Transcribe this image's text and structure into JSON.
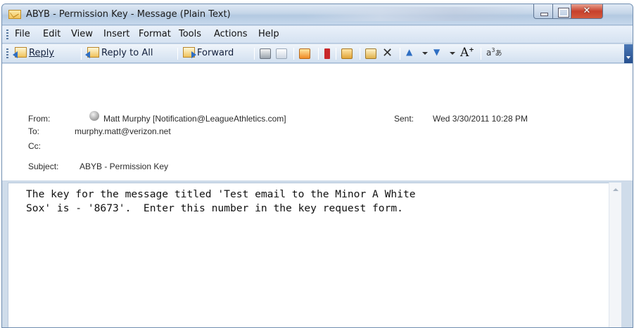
{
  "window": {
    "title": "ABYB - Permission Key - Message (Plain Text)"
  },
  "menu": [
    {
      "label": "File"
    },
    {
      "label": "Edit"
    },
    {
      "label": "View"
    },
    {
      "label": "Insert"
    },
    {
      "label": "Format"
    },
    {
      "label": "Tools"
    },
    {
      "label": "Actions"
    },
    {
      "label": "Help"
    }
  ],
  "toolbar": {
    "reply": "Reply",
    "reply_all": "Reply to All",
    "forward": "Forward",
    "font_size_up": "A",
    "superscript": "+",
    "translate_glyph": "a",
    "translate_glyph_2": "あ",
    "delete_glyph": "✕"
  },
  "header": {
    "from_label": "From:",
    "from_value": "Matt Murphy [Notification@LeagueAthletics.com]",
    "sent_label": "Sent:",
    "sent_value": "Wed 3/30/2011 10:28 PM",
    "to_label": "To:",
    "to_value": "murphy.matt@verizon.net",
    "cc_label": "Cc:",
    "subject_label": "Subject:",
    "subject_value": "ABYB - Permission Key"
  },
  "message": {
    "line1": "The key for the message titled 'Test email to the Minor A White",
    "line2": "Sox' is - '8673'.  Enter this number in the key request form."
  }
}
